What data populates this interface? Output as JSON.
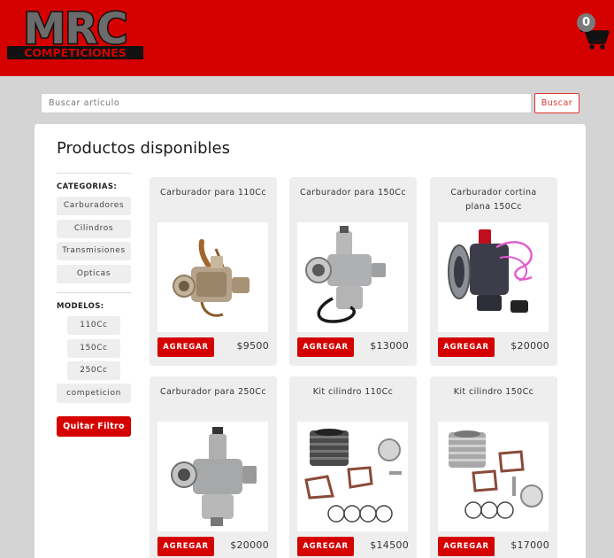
{
  "header": {
    "logo": {
      "line1": "MRC",
      "line2": "COMPETICIONES"
    },
    "cart_count": "0"
  },
  "search": {
    "placeholder": "Buscar articulo",
    "button_label": "Buscar"
  },
  "main": {
    "title": "Productos disponibles"
  },
  "sidebar": {
    "categories_heading": "CATEGORIAS:",
    "categories": [
      "Carburadores",
      "Cilindros",
      "Transmisiones",
      "Opticas"
    ],
    "models_heading": "MODELOS:",
    "models": [
      "110Cc",
      "150Cc",
      "250Cc",
      "competicion"
    ],
    "remove_filter_label": "Quitar Filtro"
  },
  "products": [
    {
      "title": "Carburador para 110Cc",
      "price": "$9500",
      "add_label": "AGREGAR",
      "image_icon": "carburetor-icon"
    },
    {
      "title": "Carburador para 150Cc",
      "price": "$13000",
      "add_label": "AGREGAR",
      "image_icon": "carburetor-icon"
    },
    {
      "title": "Carburador cortina plana 150Cc",
      "price": "$20000",
      "add_label": "AGREGAR",
      "image_icon": "carburetor-icon"
    },
    {
      "title": "Carburador para 250Cc",
      "price": "$20000",
      "add_label": "AGREGAR",
      "image_icon": "carburetor-icon"
    },
    {
      "title": "Kit cilindro 110Cc",
      "price": "$14500",
      "add_label": "AGREGAR",
      "image_icon": "cylinder-kit-icon"
    },
    {
      "title": "Kit cilindro 150Cc",
      "price": "$17000",
      "add_label": "AGREGAR",
      "image_icon": "cylinder-kit-icon"
    }
  ],
  "colors": {
    "brand_red": "#d50000",
    "background": "#d4d4d4",
    "card": "#eeeeee"
  }
}
